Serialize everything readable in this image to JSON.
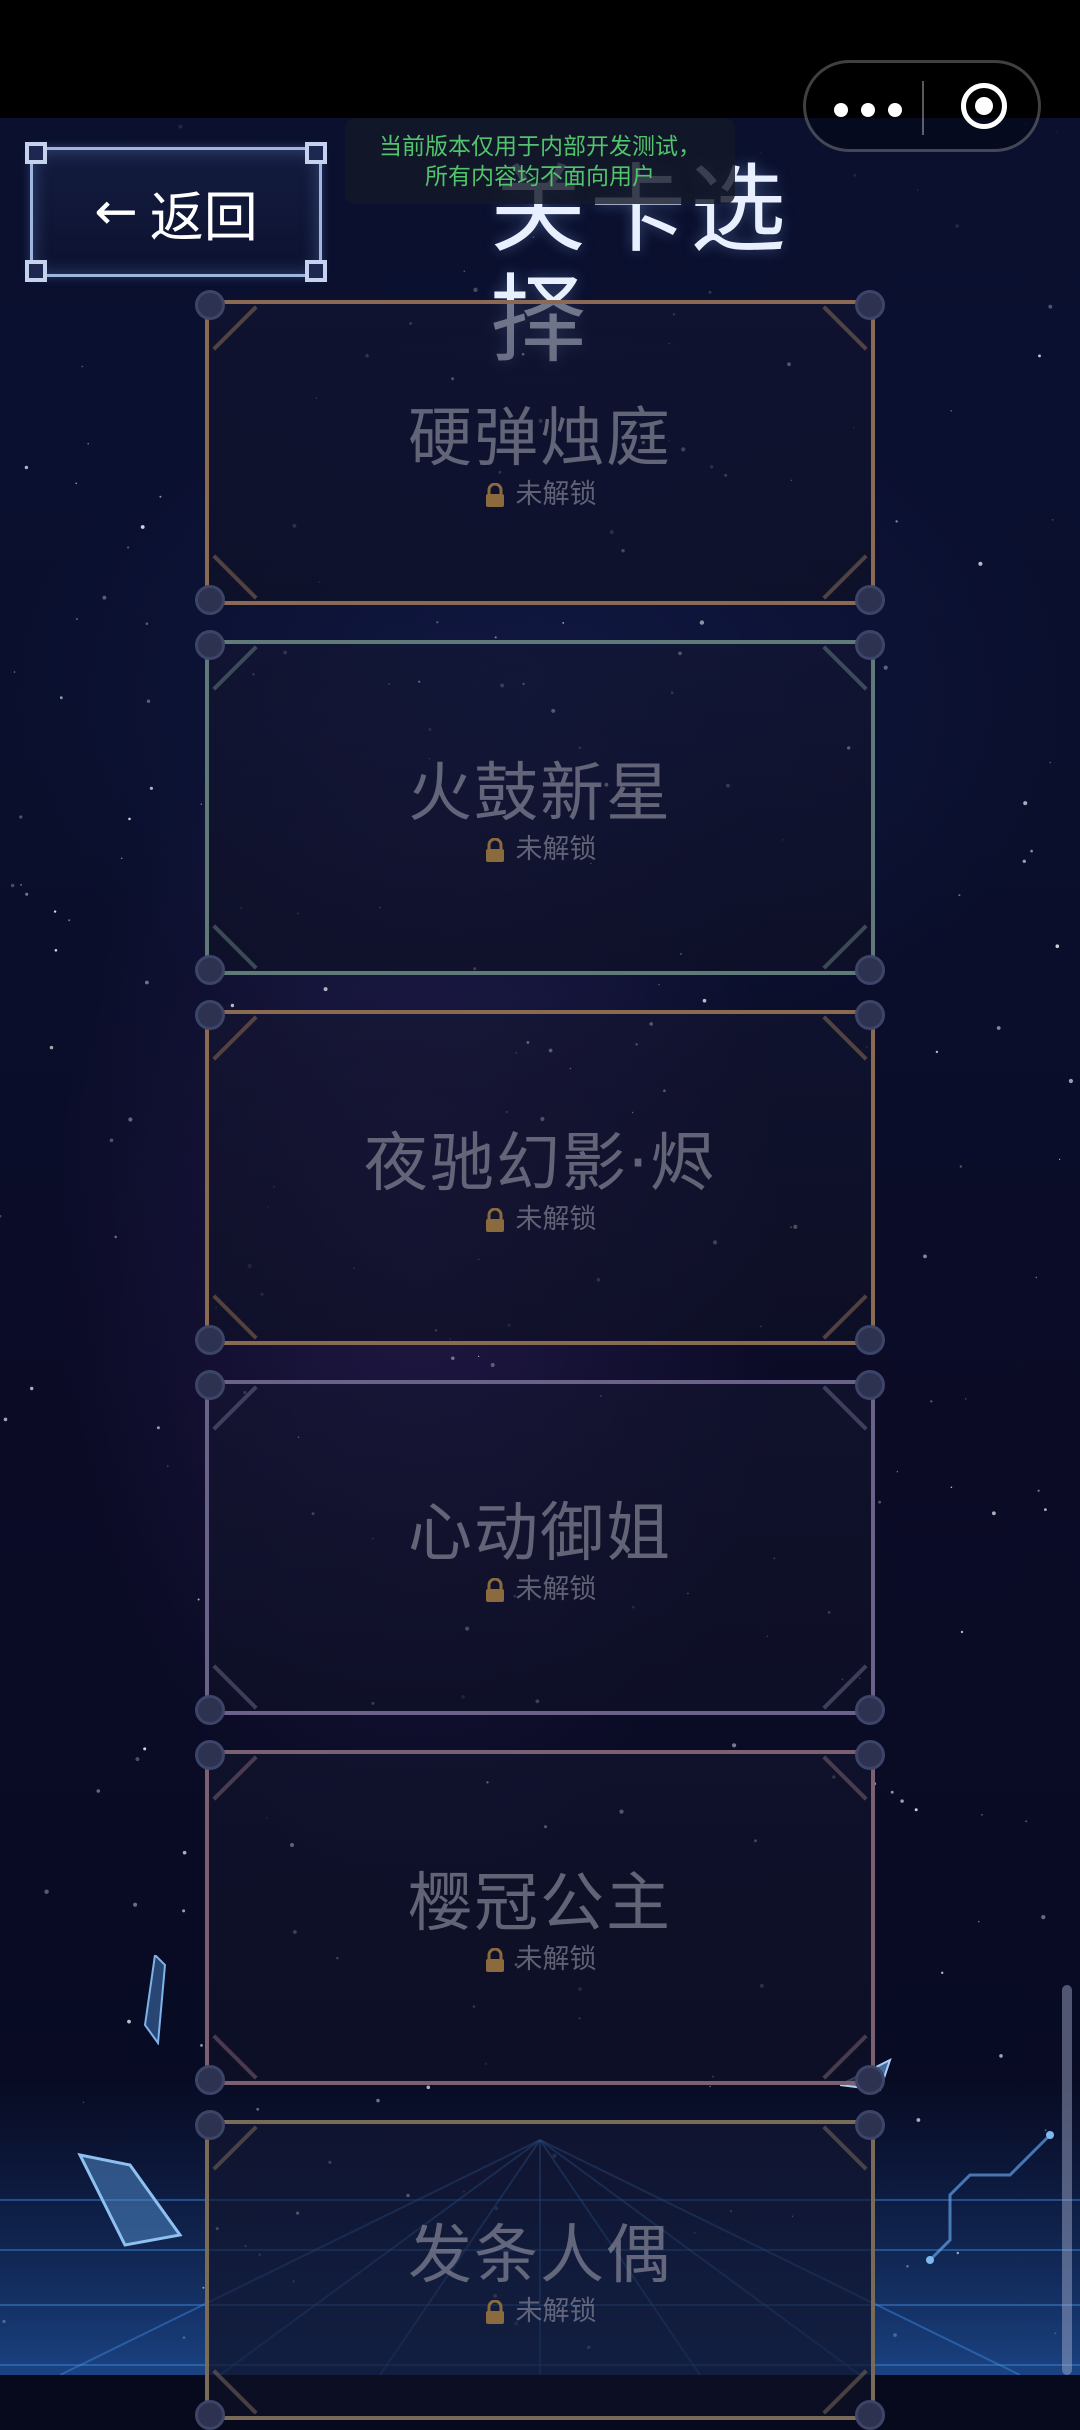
{
  "header": {
    "back_label": "返回",
    "back_arrow": "←",
    "title": "关卡选择"
  },
  "dev_notice": {
    "line1": "当前版本仅用于内部开发测试，",
    "line2": "所有内容均不面向用户"
  },
  "mini_program_capsule": {
    "more_icon": "more-dots-icon",
    "close_icon": "target-close-icon"
  },
  "levels": [
    {
      "name": "硬弹烛庭",
      "status": "未解锁",
      "accent": "#8a6a55"
    },
    {
      "name": "火鼓新星",
      "status": "未解锁",
      "accent": "#5f7a78"
    },
    {
      "name": "夜驰幻影·烬",
      "status": "未解锁",
      "accent": "#8a6a50"
    },
    {
      "name": "心动御姐",
      "status": "未解锁",
      "accent": "#6a6288"
    },
    {
      "name": "樱冠公主",
      "status": "未解锁",
      "accent": "#7a6070"
    },
    {
      "name": "发条人偶",
      "status": "未解锁",
      "accent": "#7a6a58"
    }
  ],
  "colors": {
    "lock": "#8b6a3e",
    "notice_text": "#51c46b"
  }
}
